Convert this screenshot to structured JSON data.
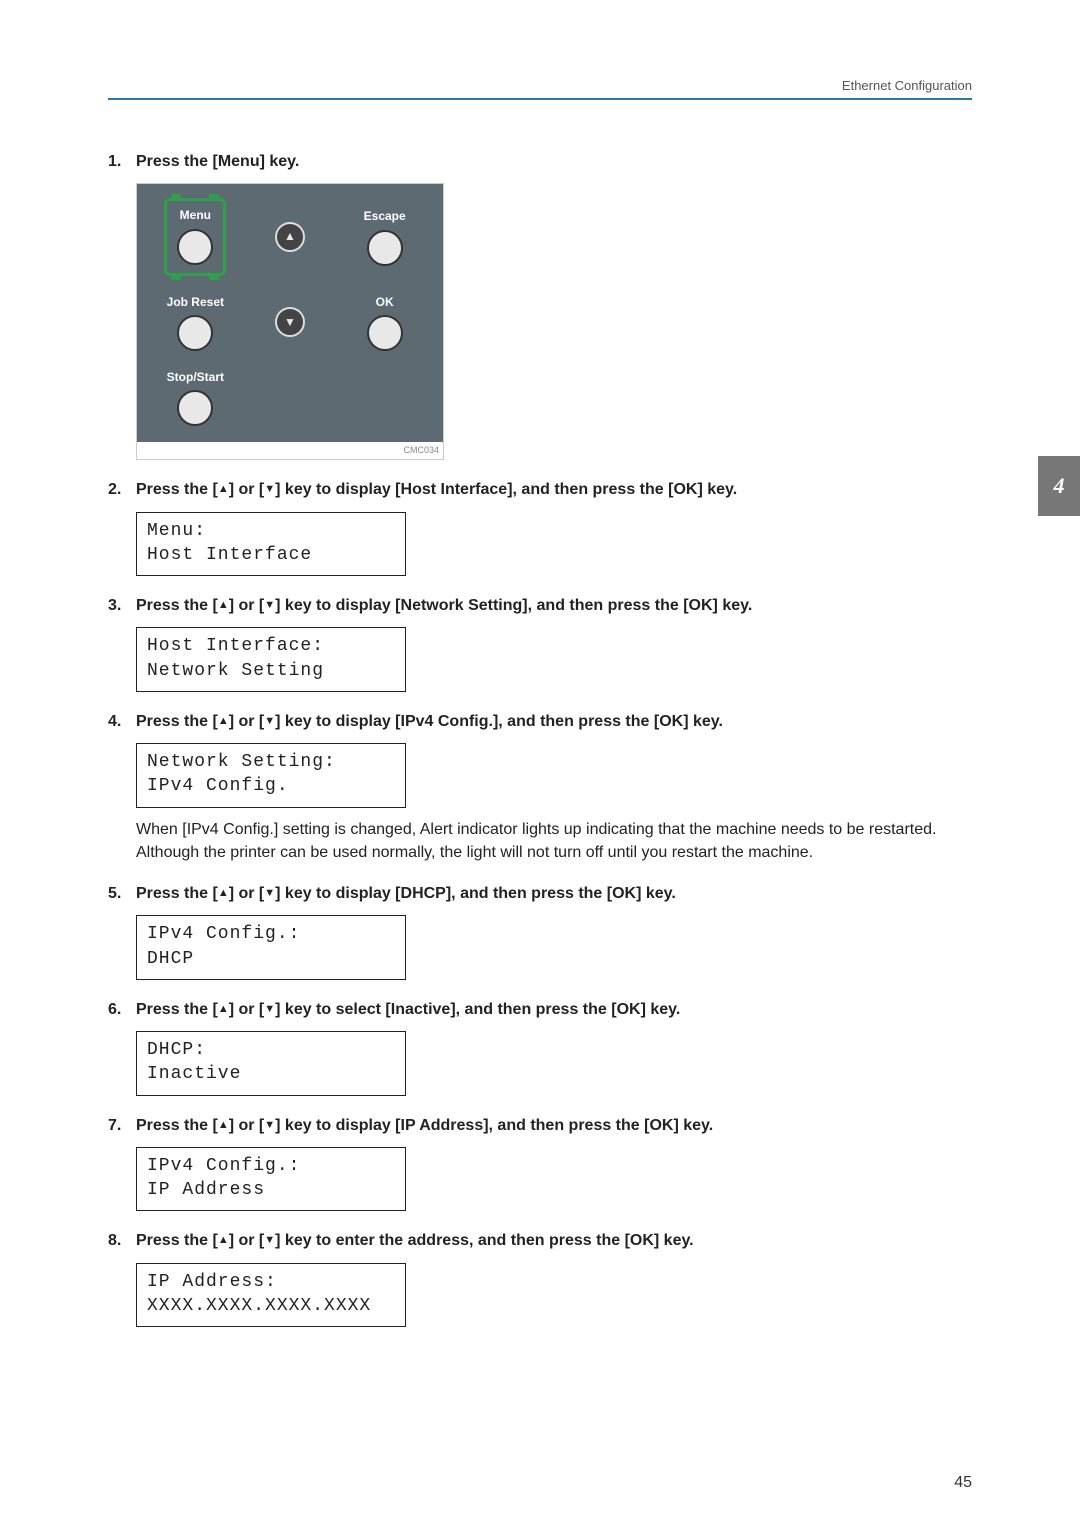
{
  "header": {
    "section": "Ethernet Configuration"
  },
  "side_tab": "4",
  "page_number": "45",
  "panel": {
    "menu": "Menu",
    "escape": "Escape",
    "job_reset": "Job Reset",
    "ok": "OK",
    "stop_start": "Stop/Start",
    "caption": "CMC034"
  },
  "steps": {
    "s1": {
      "num": "1.",
      "text": "Press the [Menu] key."
    },
    "s2": {
      "num": "2.",
      "prefix": "Press the [",
      "mid1": "] or [",
      "mid2": "] key to display [Host Interface], and then press the [OK] key."
    },
    "s3": {
      "num": "3.",
      "prefix": "Press the [",
      "mid1": "] or [",
      "mid2": "] key to display [Network Setting], and then press the [OK] key."
    },
    "s4": {
      "num": "4.",
      "prefix": "Press the [",
      "mid1": "] or [",
      "mid2": "] key to display [IPv4 Config.], and then press the [OK] key.",
      "note": "When [IPv4 Config.] setting is changed, Alert indicator lights up indicating that the machine needs to be restarted. Although the printer can be used normally, the light will not turn off until you restart the machine."
    },
    "s5": {
      "num": "5.",
      "prefix": "Press the [",
      "mid1": "] or [",
      "mid2": "] key to display [DHCP], and then press the [OK] key."
    },
    "s6": {
      "num": "6.",
      "prefix": "Press the [",
      "mid1": "] or [",
      "mid2": "] key to select [Inactive], and then press the [OK] key."
    },
    "s7": {
      "num": "7.",
      "prefix": "Press the [",
      "mid1": "] or [",
      "mid2": "] key to display [IP Address], and then press the [OK] key."
    },
    "s8": {
      "num": "8.",
      "prefix": "Press the [",
      "mid1": "] or [",
      "mid2": "] key to enter the address, and then press the [OK] key."
    }
  },
  "lcd": {
    "d2a": "Menu:",
    "d2b": " Host Interface",
    "d3a": "Host Interface:",
    "d3b": " Network Setting",
    "d4a": "Network Setting:",
    "d4b": " IPv4 Config.",
    "d5a": "IPv4 Config.:",
    "d5b": " DHCP",
    "d6a": "DHCP:",
    "d6b": " Inactive",
    "d7a": "IPv4 Config.:",
    "d7b": " IP Address",
    "d8a": "IP Address:",
    "d8b": "XXXX.XXXX.XXXX.XXXX"
  }
}
